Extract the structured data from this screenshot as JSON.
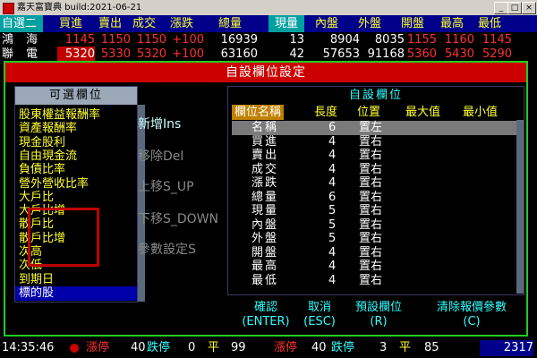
{
  "window": {
    "title": "嘉天富寶典 build:2021-06-21",
    "min_btn": "_",
    "max_btn": "□",
    "close_btn": "×"
  },
  "quote_header": {
    "group": "自選二",
    "columns": [
      "買進",
      "賣出",
      "成交",
      "漲跌",
      "總量",
      "現量",
      "內盤",
      "外盤",
      "開盤",
      "最高",
      "最低"
    ]
  },
  "quote_rows": [
    {
      "name": "鴻海",
      "bid": "1145",
      "ask": "1150",
      "last": "1150",
      "chg": "+100",
      "vol": "16939",
      "cur": "13",
      "inner": "8904",
      "outer": "8035",
      "open": "1155",
      "high": "1160",
      "low": "1145"
    },
    {
      "name": "聯電",
      "bid": "5320",
      "ask": "5330",
      "last": "5320",
      "chg": "+100",
      "vol": "63160",
      "cur": "42",
      "inner": "57653",
      "outer": "91168",
      "open": "5360",
      "high": "5430",
      "low": "5290"
    }
  ],
  "dialog": {
    "title": "自設欄位設定",
    "left_title": "可選欄位",
    "left_items": [
      "股東權益報酬率",
      "資產報酬率",
      "現金股利",
      "自由現金流",
      "負債比率",
      "營外營收比率",
      "大戶比",
      "大戶比增",
      "散戶比",
      "散戶比增",
      "次高",
      "次低",
      "到期日",
      "標的股"
    ],
    "left_selected_index": 13,
    "actions": [
      {
        "label": "新增Ins",
        "enabled": true
      },
      {
        "label": "移除Del",
        "enabled": false
      },
      {
        "label": "上移S_UP",
        "enabled": false
      },
      {
        "label": "下移S_DOWN",
        "enabled": false
      },
      {
        "label": "參數設定S",
        "enabled": false
      }
    ],
    "right_title": "自設欄位",
    "right_columns": [
      "欄位名稱",
      "長度",
      "位置",
      "最大值",
      "最小值"
    ],
    "fields": [
      {
        "name": "名稱",
        "len": "6",
        "pos": "置左"
      },
      {
        "name": "買進",
        "len": "4",
        "pos": "置右"
      },
      {
        "name": "賣出",
        "len": "4",
        "pos": "置右"
      },
      {
        "name": "成交",
        "len": "4",
        "pos": "置右"
      },
      {
        "name": "漲跌",
        "len": "4",
        "pos": "置右"
      },
      {
        "name": "總量",
        "len": "6",
        "pos": "置右"
      },
      {
        "name": "現量",
        "len": "5",
        "pos": "置右"
      },
      {
        "name": "內盤",
        "len": "5",
        "pos": "置右"
      },
      {
        "name": "外盤",
        "len": "5",
        "pos": "置右"
      },
      {
        "name": "開盤",
        "len": "4",
        "pos": "置右"
      },
      {
        "name": "最高",
        "len": "4",
        "pos": "置右"
      },
      {
        "name": "最低",
        "len": "4",
        "pos": "置右"
      }
    ],
    "footer": [
      {
        "label": "確認",
        "key": "(ENTER)"
      },
      {
        "label": "取消",
        "key": "(ESC)"
      },
      {
        "label": "預設欄位",
        "key": "(R)"
      },
      {
        "label": "清除報價參數",
        "key": "(C)"
      }
    ]
  },
  "status": {
    "time": "14:35:46",
    "limit_up_label": "漲停",
    "limit_up_count": "40",
    "limit_down_label": "跌停",
    "zero_count": "0",
    "flat_label": "平",
    "flat_count": "99",
    "limit_up_label2": "漲停",
    "limit_up_count2": "40",
    "limit_down_label2": "跌停",
    "down_count2": "3",
    "flat_label2": "平",
    "flat_count2": "85",
    "index_value": "2317"
  },
  "colors": {
    "accent_red": "#cc0000",
    "dialog_border": "#22cc22",
    "header_blue": "#00008a",
    "field_yellow": "#ffff33",
    "field_cyan": "#33ffff"
  }
}
